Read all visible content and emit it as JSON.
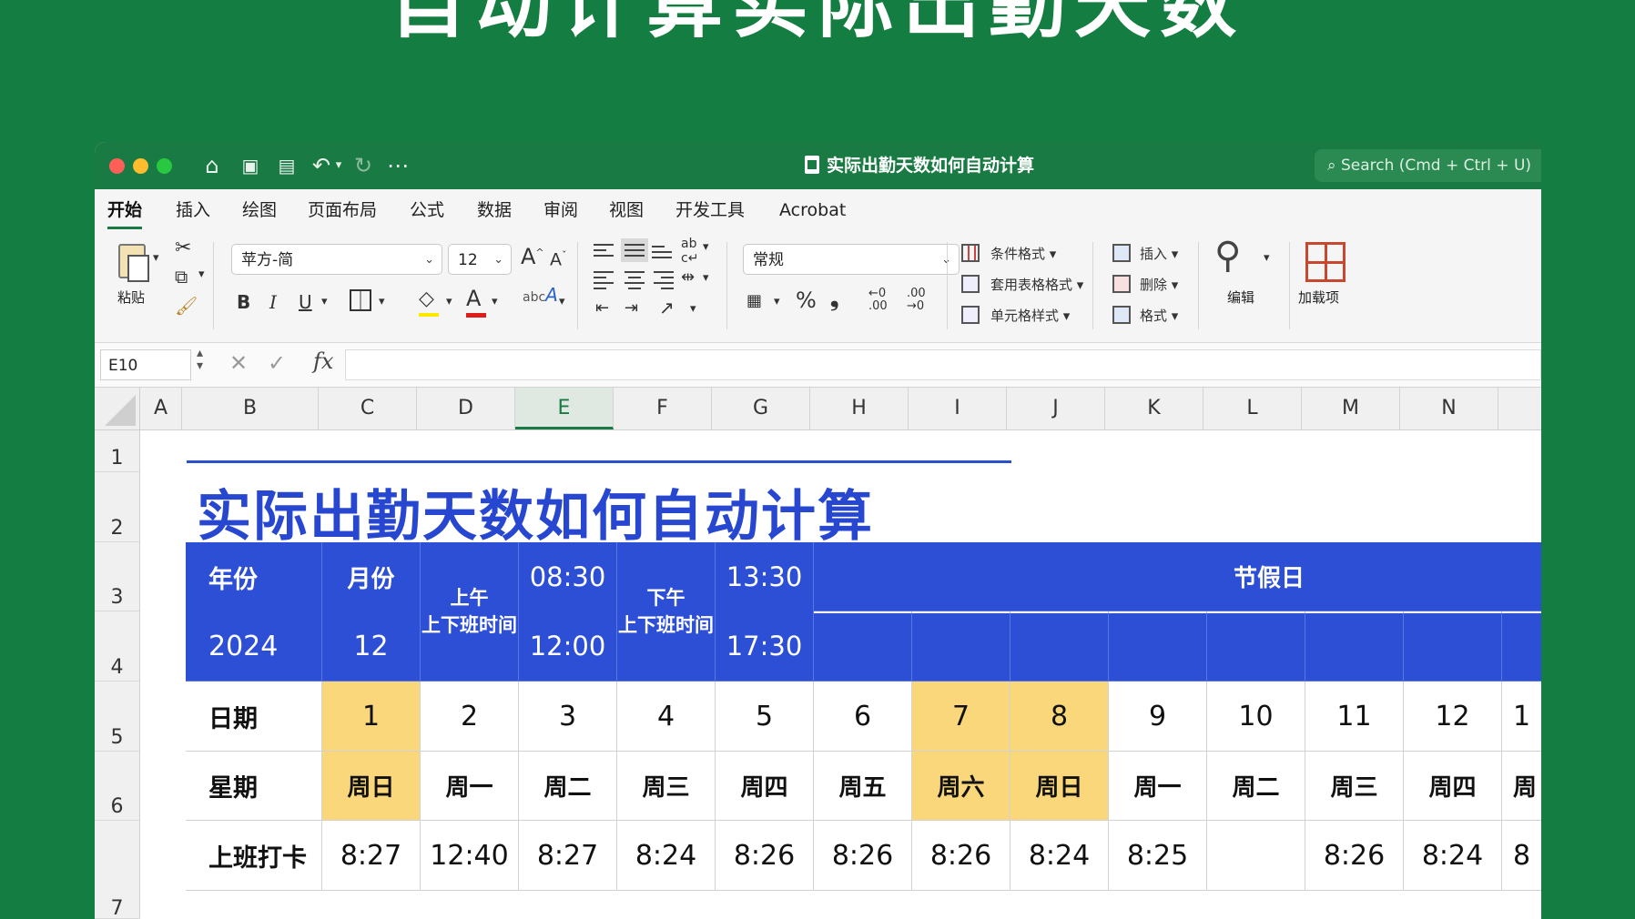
{
  "banner": {
    "title": "自动计算实际出勤天数"
  },
  "window": {
    "title": "实际出勤天数如何自动计算",
    "search_placeholder": "Search (Cmd + Ctrl + U)",
    "toolbar_icons": [
      "home-icon",
      "save-icon",
      "save-as-icon",
      "undo-icon",
      "redo-icon",
      "more-icon"
    ]
  },
  "menu": {
    "tabs": [
      "开始",
      "插入",
      "绘图",
      "页面布局",
      "公式",
      "数据",
      "审阅",
      "视图",
      "开发工具",
      "Acrobat"
    ],
    "active": "开始"
  },
  "ribbon": {
    "paste_label": "粘贴",
    "font_name": "苹方-简",
    "font_size": "12",
    "bold": "B",
    "italic": "I",
    "underline": "U",
    "grow_font": "A",
    "shrink_font": "A",
    "number_format": "常规",
    "percent": "%",
    "comma": "❟",
    "conditional_format": "条件格式",
    "table_format": "套用表格格式",
    "cell_style": "单元格样式",
    "insert": "插入",
    "delete": "删除",
    "format": "格式",
    "edit": "编辑",
    "addins": "加载项"
  },
  "formula_bar": {
    "name_box": "E10",
    "fx": "fx",
    "formula": ""
  },
  "columns": [
    "A",
    "B",
    "C",
    "D",
    "E",
    "F",
    "G",
    "H",
    "I",
    "J",
    "K",
    "L",
    "M",
    "N"
  ],
  "selected_column": "E",
  "rows": [
    "1",
    "2",
    "3",
    "4",
    "5",
    "6",
    "7"
  ],
  "sheet": {
    "title": "实际出勤天数如何自动计算",
    "header": {
      "year_label": "年份",
      "year": "2024",
      "month_label": "月份",
      "month": "12",
      "am_label": "上午\n上下班时间",
      "am_start": "08:30",
      "am_end": "12:00",
      "pm_label": "下午\n上下班时间",
      "pm_start": "13:30",
      "pm_end": "17:30",
      "holiday_label": "节假日"
    },
    "date_label": "日期",
    "dates": [
      "1",
      "2",
      "3",
      "4",
      "5",
      "6",
      "7",
      "8",
      "9",
      "10",
      "11",
      "12",
      "1"
    ],
    "weekday_label": "星期",
    "weekdays": [
      "周日",
      "周一",
      "周二",
      "周三",
      "周四",
      "周五",
      "周六",
      "周日",
      "周一",
      "周二",
      "周三",
      "周四",
      "周"
    ],
    "checkin_label": "上班打卡",
    "checkins": [
      "8:27",
      "12:40",
      "8:27",
      "8:24",
      "8:26",
      "8:26",
      "8:26",
      "8:24",
      "8:25",
      "",
      "8:26",
      "8:24",
      "8"
    ],
    "weekend_highlight": [
      true,
      false,
      false,
      false,
      false,
      false,
      true,
      true,
      false,
      false,
      false,
      false,
      false
    ],
    "colors": {
      "header_blue": "#2d4fd6",
      "weekend_yellow": "#f9d77a",
      "title_blue": "#2747d0",
      "excel_green": "#1a7a43"
    }
  }
}
